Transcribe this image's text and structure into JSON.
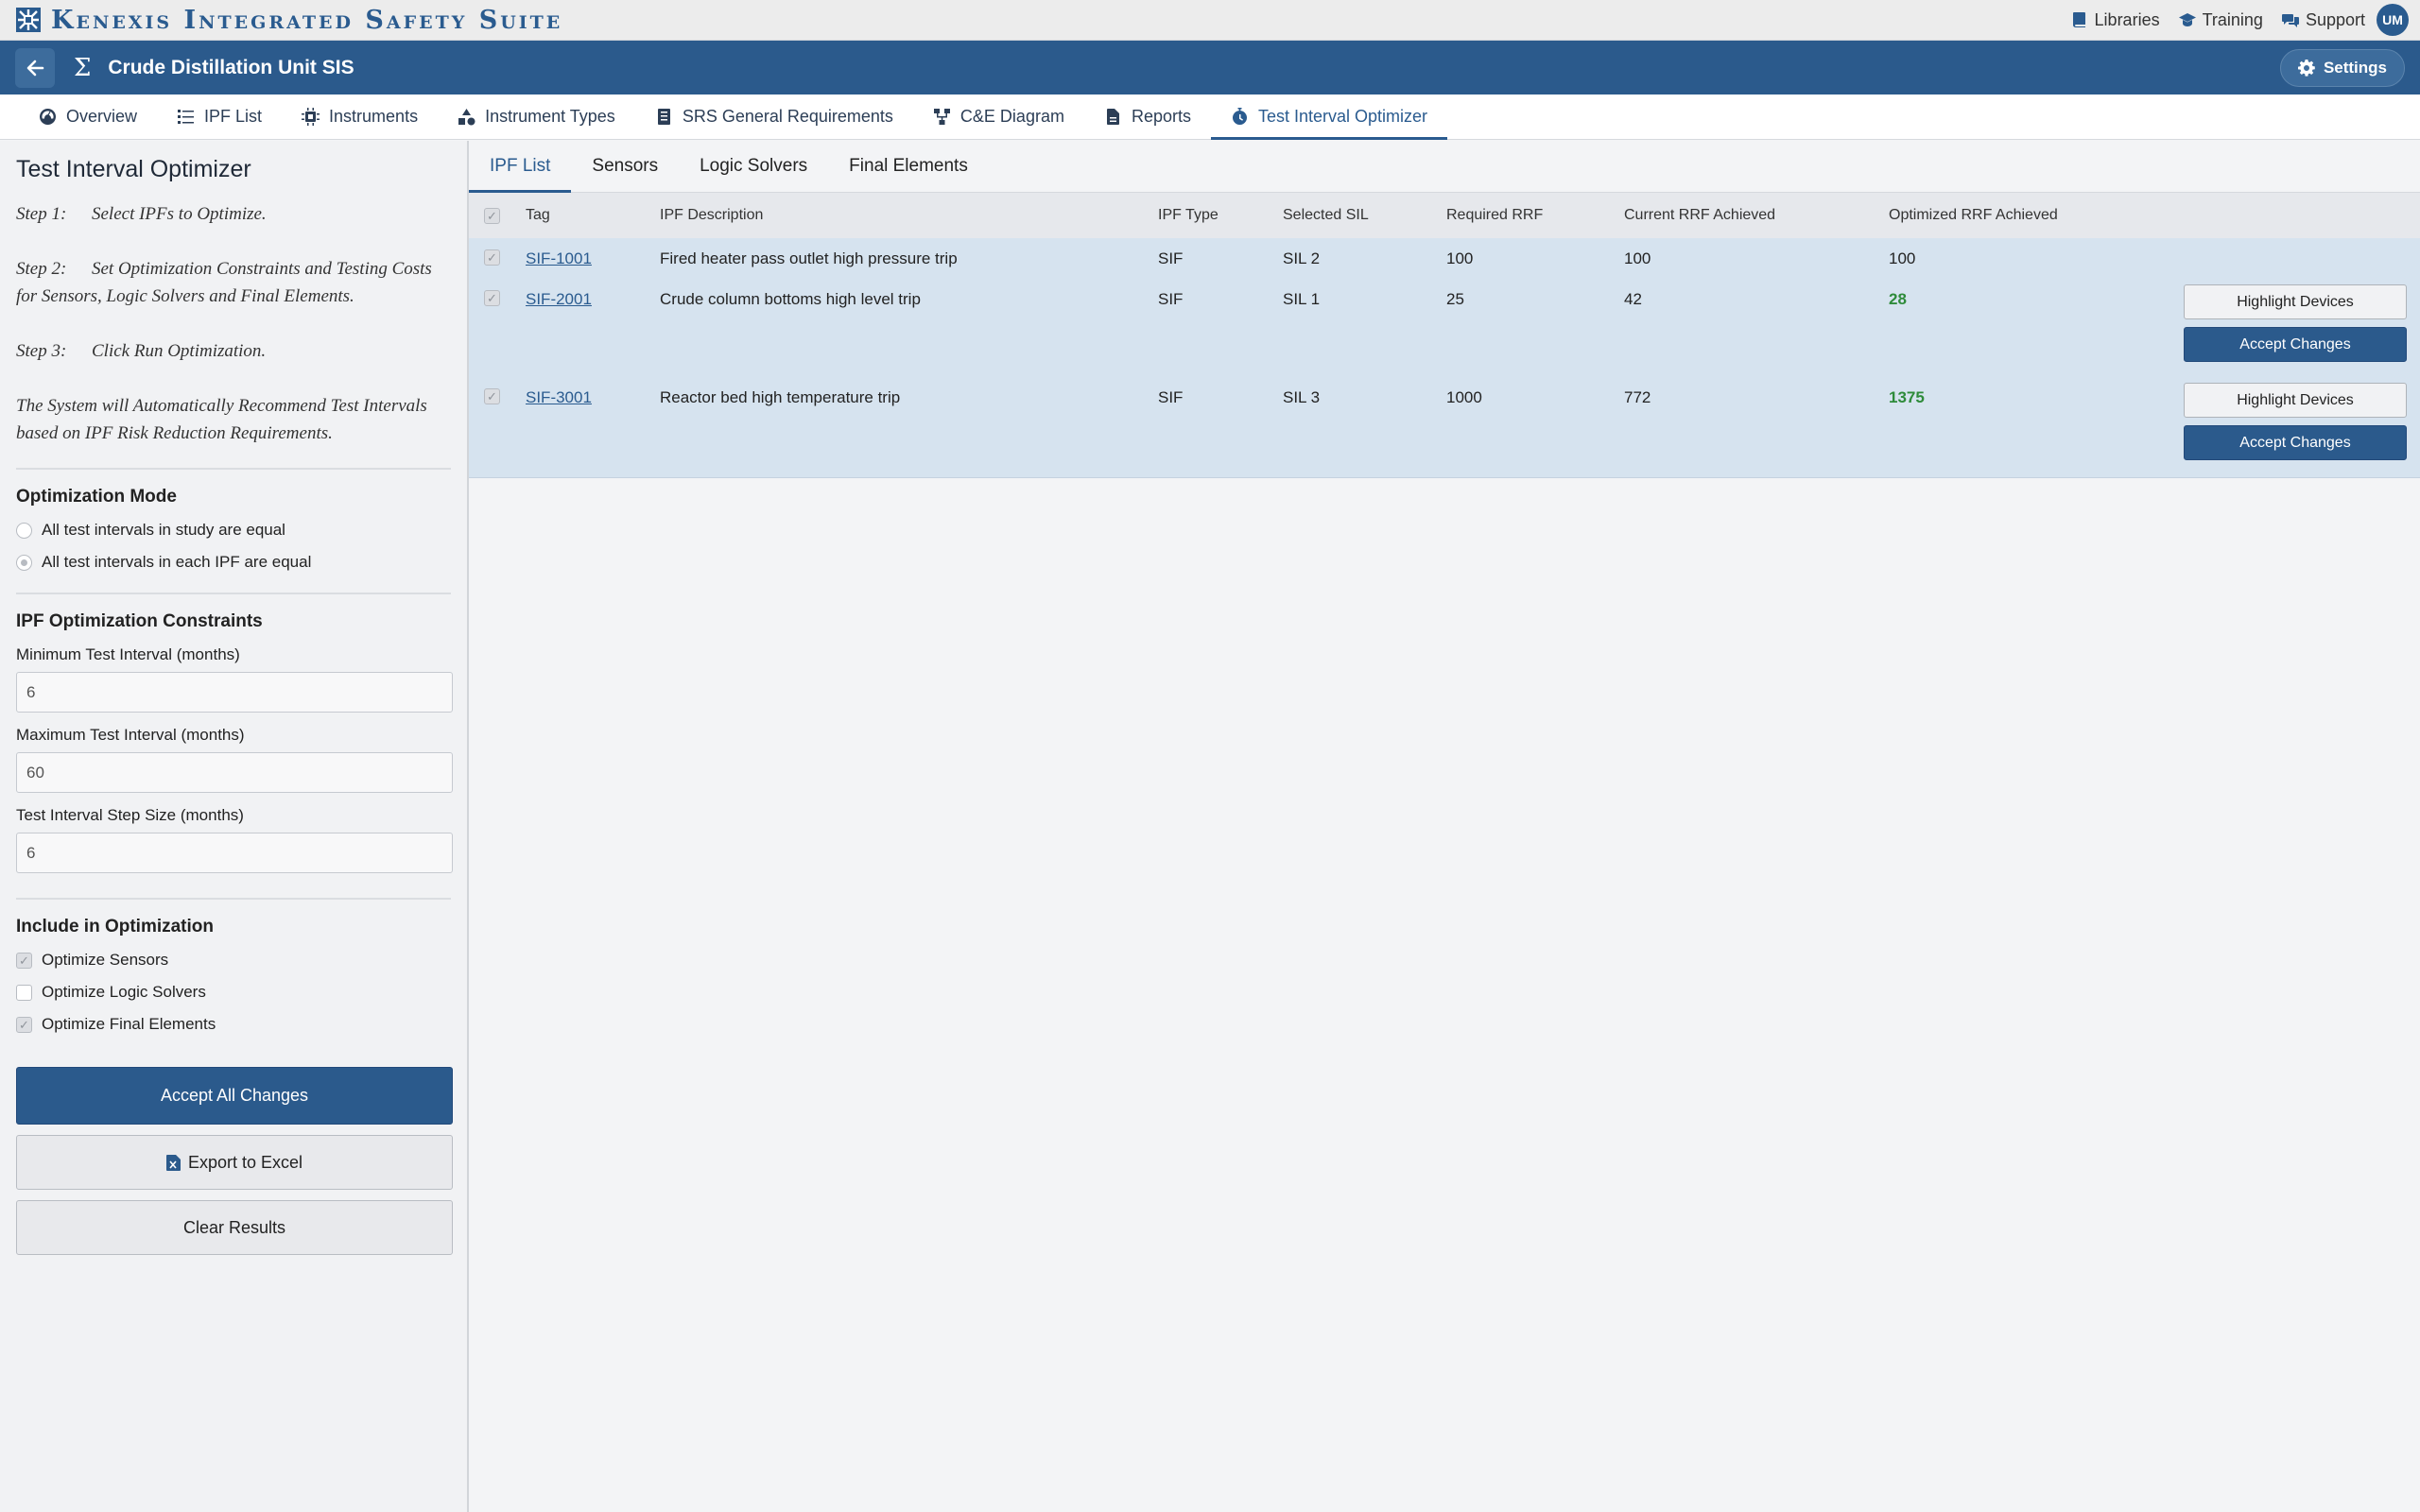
{
  "app": {
    "brand": "Kenexis Integrated Safety Suite",
    "brand_color": "#2a5b8f",
    "top_links": [
      {
        "label": "Libraries",
        "icon": "book-icon"
      },
      {
        "label": "Training",
        "icon": "graduation-cap-icon"
      },
      {
        "label": "Support",
        "icon": "chat-icon"
      }
    ],
    "user_initials": "UM"
  },
  "project": {
    "title": "Crude Distillation Unit SIS",
    "settings_label": "Settings",
    "bar_color": "#2b5a8c"
  },
  "nav_tabs": [
    {
      "label": "Overview",
      "icon": "gauge-icon"
    },
    {
      "label": "IPF List",
      "icon": "list-icon"
    },
    {
      "label": "Instruments",
      "icon": "chip-icon"
    },
    {
      "label": "Instrument Types",
      "icon": "shapes-icon"
    },
    {
      "label": "SRS General Requirements",
      "icon": "document-list-icon"
    },
    {
      "label": "C&E Diagram",
      "icon": "diagram-icon"
    },
    {
      "label": "Reports",
      "icon": "file-icon"
    },
    {
      "label": "Test Interval Optimizer",
      "icon": "stopwatch-icon",
      "active": true
    }
  ],
  "left": {
    "title": "Test Interval Optimizer",
    "steps": [
      {
        "num": "Step 1:",
        "text": "Select IPFs to Optimize."
      },
      {
        "num": "Step 2:",
        "text": "Set Optimization Constraints and Testing Costs for Sensors, Logic Solvers and Final Elements."
      },
      {
        "num": "Step 3:",
        "text": "Click Run Optimization."
      }
    ],
    "auto_text": "The System will Automatically Recommend Test Intervals based on IPF Risk Reduction Requirements.",
    "mode": {
      "title": "Optimization Mode",
      "options": [
        {
          "label": "All test intervals in study are equal",
          "selected": false
        },
        {
          "label": "All test intervals in each IPF are equal",
          "selected": true
        }
      ]
    },
    "constraints": {
      "title": "IPF Optimization Constraints",
      "min_label": "Minimum Test Interval (months)",
      "min_value": "6",
      "max_label": "Maximum Test Interval (months)",
      "max_value": "60",
      "step_label": "Test Interval Step Size (months)",
      "step_value": "6"
    },
    "include": {
      "title": "Include in Optimization",
      "items": [
        {
          "label": "Optimize Sensors",
          "checked": true
        },
        {
          "label": "Optimize Logic Solvers",
          "checked": false
        },
        {
          "label": "Optimize Final Elements",
          "checked": true
        }
      ]
    },
    "buttons": {
      "accept_all": "Accept All Changes",
      "export": "Export to Excel",
      "clear": "Clear Results"
    }
  },
  "sub_tabs": [
    "IPF List",
    "Sensors",
    "Logic Solvers",
    "Final Elements"
  ],
  "table": {
    "columns": [
      "Tag",
      "IPF Description",
      "IPF Type",
      "Selected SIL",
      "Required RRF",
      "Current RRF Achieved",
      "Optimized RRF Achieved"
    ],
    "rows": [
      {
        "tag": "SIF-1001",
        "desc": "Fired heater pass outlet high pressure trip",
        "type": "SIF",
        "sil": "SIL 2",
        "req": "100",
        "cur": "100",
        "opt": "100",
        "opt_highlight": false,
        "actions": false
      },
      {
        "tag": "SIF-2001",
        "desc": "Crude column bottoms high level trip",
        "type": "SIF",
        "sil": "SIL 1",
        "req": "25",
        "cur": "42",
        "opt": "28",
        "opt_highlight": true,
        "actions": true
      },
      {
        "tag": "SIF-3001",
        "desc": "Reactor bed high temperature trip",
        "type": "SIF",
        "sil": "SIL 3",
        "req": "1000",
        "cur": "772",
        "opt": "1375",
        "opt_highlight": true,
        "actions": true
      }
    ],
    "highlight_label": "Highlight Devices",
    "accept_label": "Accept Changes",
    "highlight_color": "#2e8b3a",
    "row_color": "#d6e3ef"
  }
}
